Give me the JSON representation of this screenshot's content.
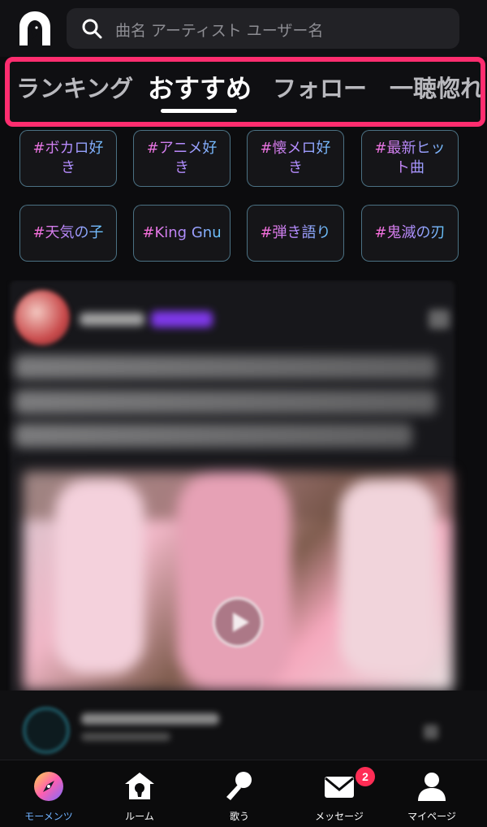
{
  "header": {
    "search_placeholder": "曲名 アーティスト ユーザー名"
  },
  "tabs": [
    {
      "label": "ランキング",
      "active": false
    },
    {
      "label": "おすすめ",
      "active": true
    },
    {
      "label": "フォロー",
      "active": false
    },
    {
      "label": "一聴惚れ",
      "active": false
    }
  ],
  "tags": [
    "#ボカロ好き",
    "#アニメ好き",
    "#懐メロ好き",
    "#最新ヒット曲",
    "#天気の子",
    "#King Gnu",
    "#弾き語り",
    "#鬼滅の刃"
  ],
  "bottom_nav": [
    {
      "label": "モーメンツ",
      "icon": "moments-compass-icon",
      "active": true
    },
    {
      "label": "ルーム",
      "icon": "room-house-icon",
      "active": false
    },
    {
      "label": "歌う",
      "icon": "microphone-icon",
      "active": false
    },
    {
      "label": "メッセージ",
      "icon": "mail-icon",
      "active": false,
      "badge": "2"
    },
    {
      "label": "マイページ",
      "icon": "person-icon",
      "active": false
    }
  ],
  "colors": {
    "tab_highlight_border": "#ff2d6f",
    "badge": "#ff2d55",
    "active_nav": "#6fb2ff"
  }
}
